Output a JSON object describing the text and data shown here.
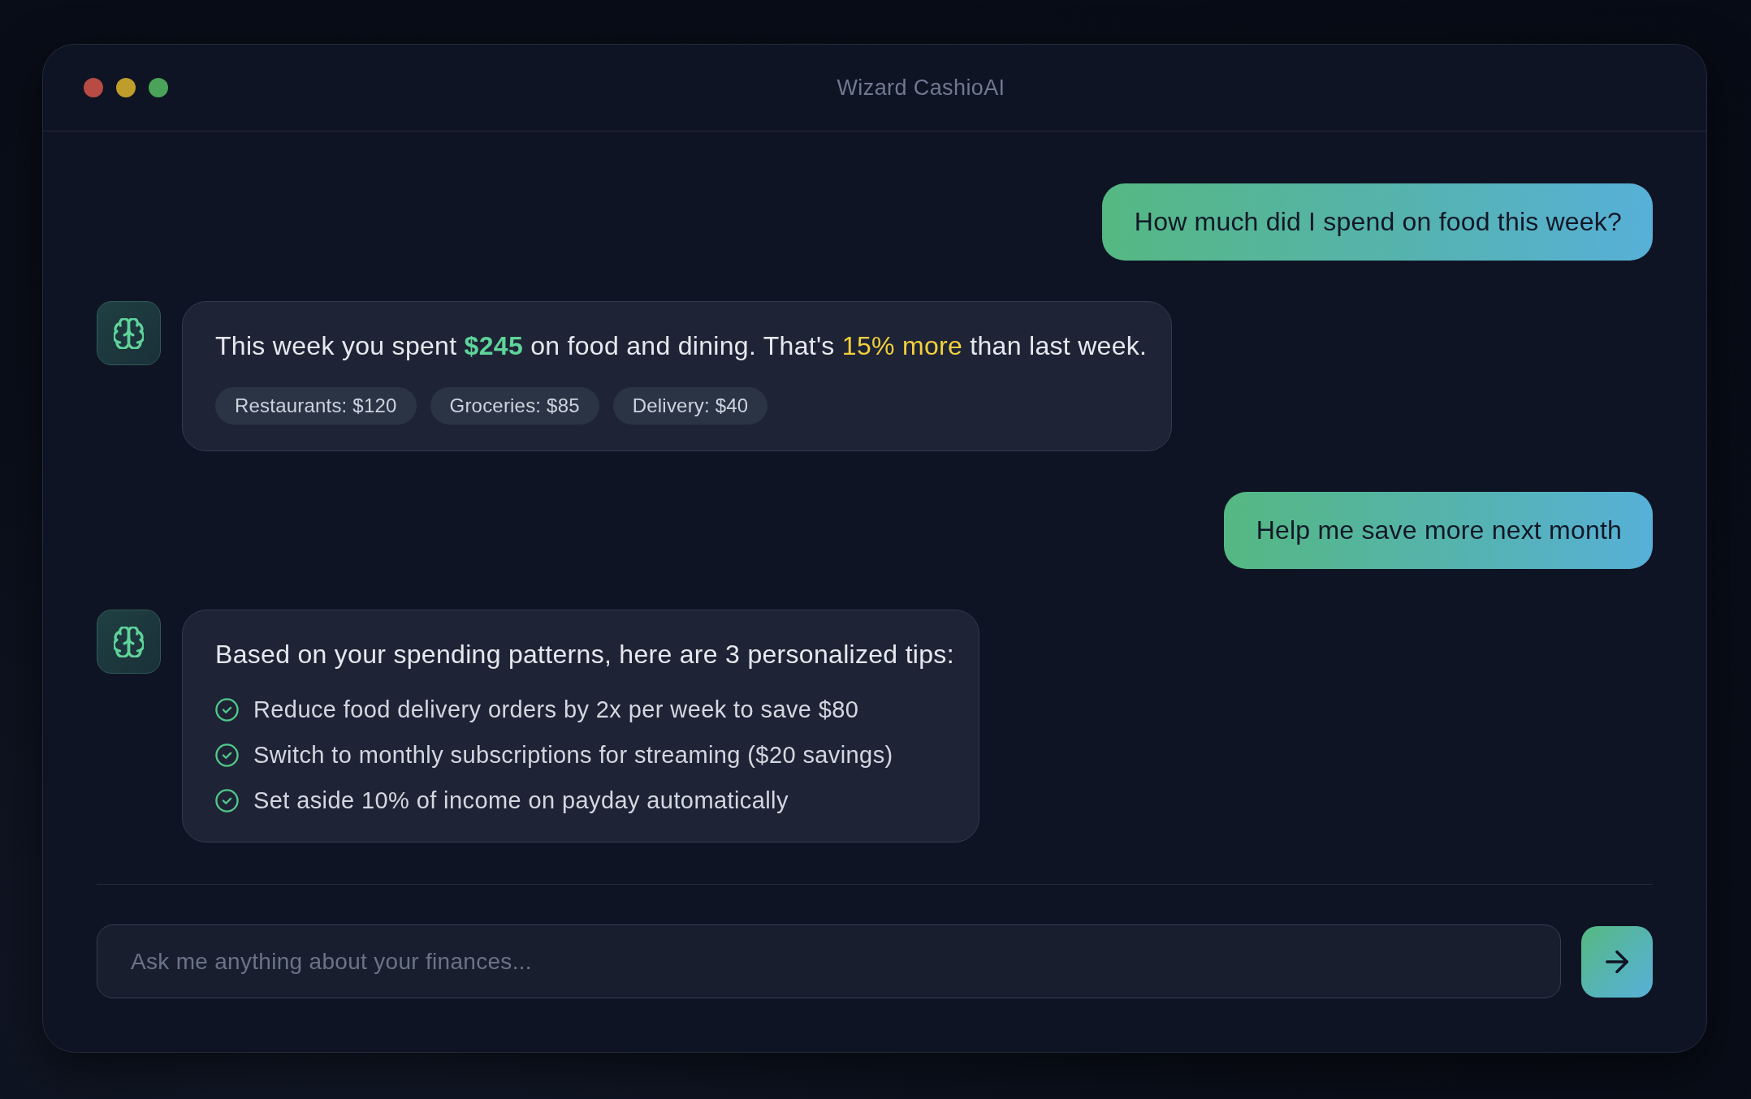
{
  "window": {
    "title": "Wizard CashioAI"
  },
  "messages": [
    {
      "kind": "user",
      "text": "How much did I spend on food this week?"
    },
    {
      "kind": "assistant",
      "parts": [
        {
          "kind": "plain",
          "text": "This week you spent "
        },
        {
          "kind": "amount",
          "text": "$245"
        },
        {
          "kind": "plain",
          "text": " on food and dining. That's "
        },
        {
          "kind": "increase",
          "text": "15% more"
        },
        {
          "kind": "plain",
          "text": " than last week."
        }
      ],
      "chips": [
        "Restaurants: $120",
        "Groceries: $85",
        "Delivery: $40"
      ]
    },
    {
      "kind": "user",
      "text": "Help me save more next month"
    },
    {
      "kind": "assistant",
      "parts": [
        {
          "kind": "plain",
          "text": "Based on your spending patterns, here are 3 personalized tips:"
        }
      ],
      "tips": [
        "Reduce food delivery orders by 2x per week to save $80",
        "Switch to monthly subscriptions for streaming ($20 savings)",
        "Set aside 10% of income on payday automatically"
      ]
    }
  ],
  "composer": {
    "placeholder": "Ask me anything about your finances..."
  }
}
